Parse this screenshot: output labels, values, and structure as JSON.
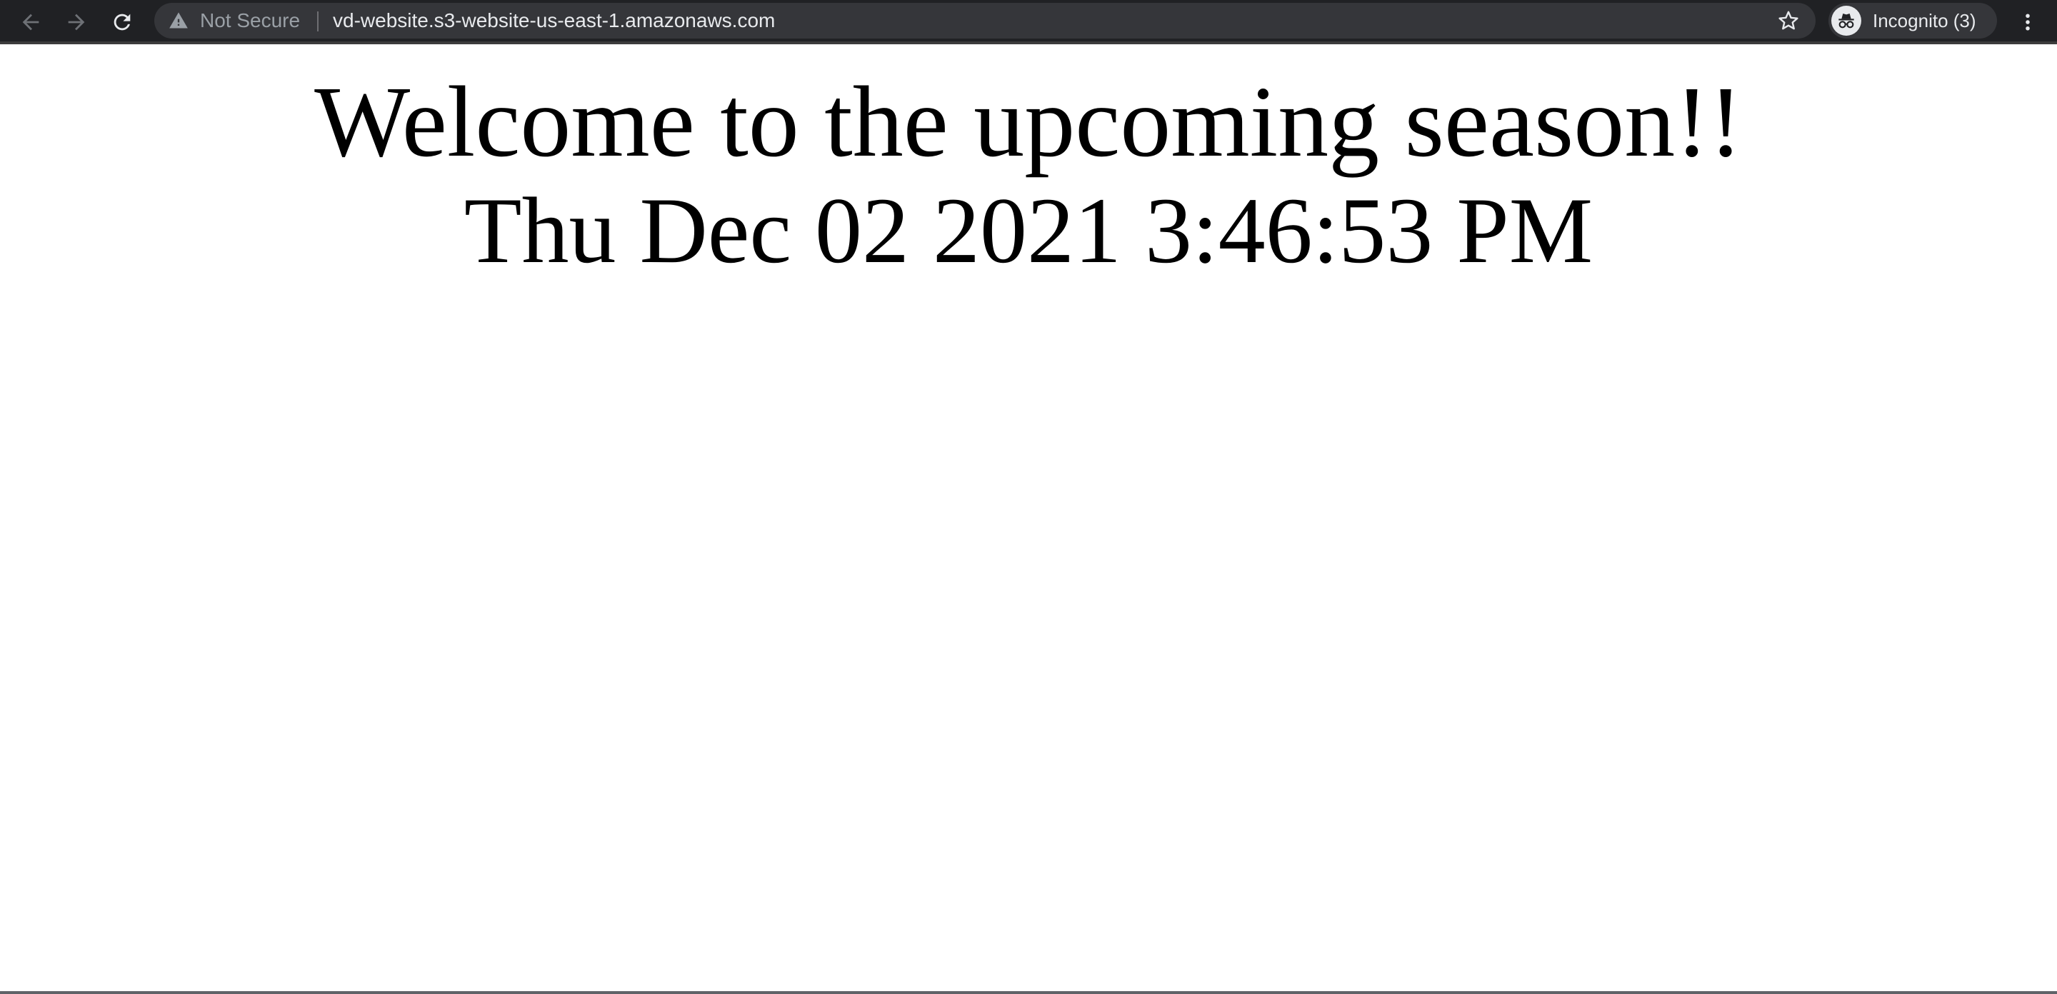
{
  "browser": {
    "security_label": "Not Secure",
    "url": "vd-website.s3-website-us-east-1.amazonaws.com",
    "profile_label": "Incognito (3)",
    "icons": {
      "back": "back-arrow-icon",
      "forward": "forward-arrow-icon",
      "reload": "reload-icon",
      "security": "warning-triangle-icon",
      "bookmark": "star-icon",
      "profile": "incognito-icon",
      "menu": "kebab-menu-icon"
    },
    "colors": {
      "toolbar_bg": "#202124",
      "omnibox_bg": "#35363a",
      "url_text": "#e8eaed",
      "muted_text": "#9aa0a6"
    }
  },
  "page": {
    "heading": "Welcome to the upcoming season!!",
    "datetime": "Thu Dec 02 2021 3:46:53 PM"
  }
}
